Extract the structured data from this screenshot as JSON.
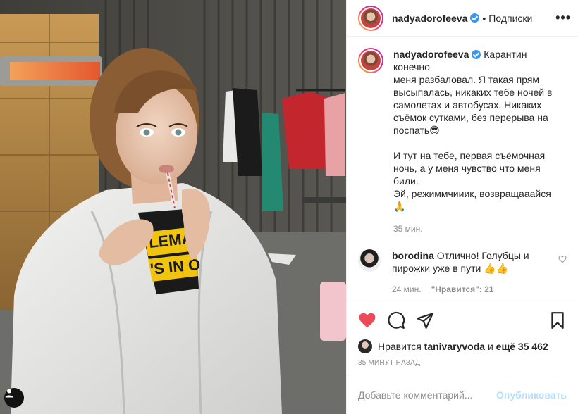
{
  "header": {
    "username": "nadyadorofeeva",
    "separator": "•",
    "follow_label": "Подписки",
    "more_label": "•••"
  },
  "caption": {
    "username": "nadyadorofeeva",
    "text": "Карантин\nконечно\nменя разбаловал. Я такая прям высыпалась, никаких тебе ночей в самолетах и автобусах. Никаких съёмок сутками, без перерыва на поспать😎\n\nИ тут на тебе, первая съёмочная ночь, а у меня чувство что меня били.\nЭй, режиммчииик, возвращааайся\n🙏",
    "time": "35 мин."
  },
  "comment": {
    "username": "borodina",
    "text": "Отлично! Голубцы и пирожки уже в пути 👍👍",
    "time": "24 мин.",
    "likes": "\"Нравится\": 21"
  },
  "likes": {
    "prefix": "Нравится",
    "user": "tanivaryvoda",
    "joiner": "и",
    "rest": "ещё 35 462"
  },
  "timestamp": "35 МИНУТ НАЗАД",
  "add_comment": {
    "placeholder": "Добавьте комментарий...",
    "publish_label": "Опубликовать"
  },
  "photo": {
    "cup_text_line1": "LEMAN",
    "cup_text_line2": "'S IN O"
  },
  "colors": {
    "like_red": "#ed4956",
    "verified_blue": "#3897f0",
    "publish_disabled": "#b2dffc"
  }
}
